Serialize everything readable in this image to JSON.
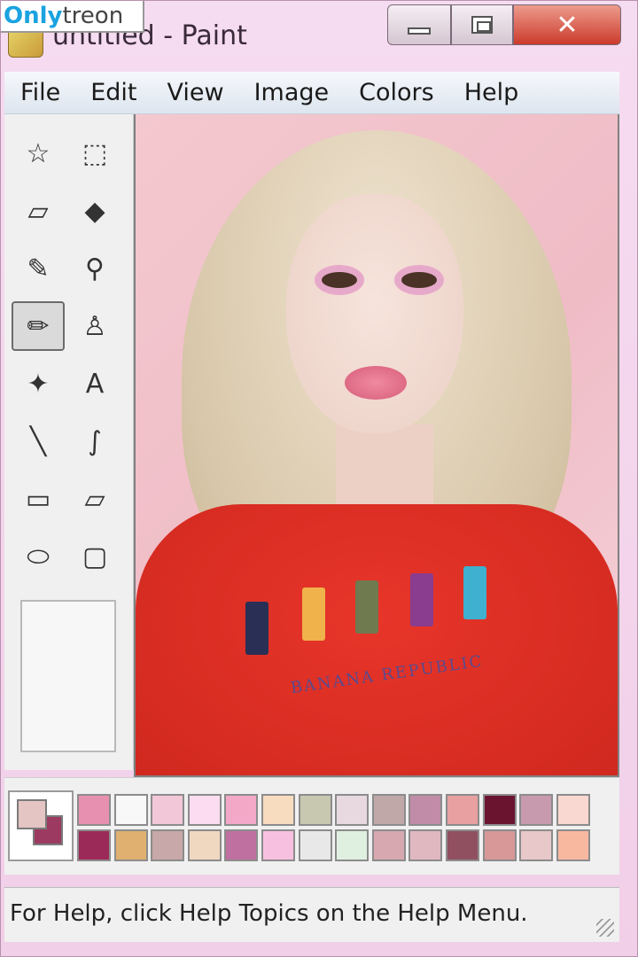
{
  "watermark": {
    "part1": "Only",
    "part2": "treon"
  },
  "window": {
    "title": "untitled - Paint",
    "close_glyph": "✕"
  },
  "menu": [
    "File",
    "Edit",
    "View",
    "Image",
    "Colors",
    "Help"
  ],
  "tools": [
    {
      "name": "free-form-select-icon",
      "glyph": "☆"
    },
    {
      "name": "select-icon",
      "glyph": "⬚"
    },
    {
      "name": "eraser-icon",
      "glyph": "▱"
    },
    {
      "name": "fill-bucket-icon",
      "glyph": "◆"
    },
    {
      "name": "color-picker-icon",
      "glyph": "✎"
    },
    {
      "name": "magnifier-icon",
      "glyph": "⚲"
    },
    {
      "name": "pencil-icon",
      "glyph": "✏",
      "selected": true
    },
    {
      "name": "brush-icon",
      "glyph": "♙"
    },
    {
      "name": "airbrush-icon",
      "glyph": "✦"
    },
    {
      "name": "text-icon",
      "glyph": "A"
    },
    {
      "name": "line-icon",
      "glyph": "╲"
    },
    {
      "name": "curve-icon",
      "glyph": "∫"
    },
    {
      "name": "rectangle-icon",
      "glyph": "▭"
    },
    {
      "name": "polygon-icon",
      "glyph": "⏥"
    },
    {
      "name": "ellipse-icon",
      "glyph": "⬭"
    },
    {
      "name": "rounded-rectangle-icon",
      "glyph": "▢"
    }
  ],
  "colors": {
    "foreground": "#e5c4c4",
    "background": "#9c3a61",
    "palette_top": [
      "#e890b0",
      "#f8f8f8",
      "#f2c8d8",
      "#fbdcf0",
      "#f4a8c8",
      "#f8dcc0",
      "#c8c8b0",
      "#e8d8e0",
      "#c0a8a8",
      "#c08ca8",
      "#e8a0a0",
      "#6a1430",
      "#c89aae",
      "#f8d8d0"
    ],
    "palette_bottom": [
      "#9c2a58",
      "#e0b070",
      "#c8a8a8",
      "#f0d8c0",
      "#c070a0",
      "#f8c0e0",
      "#e8e8e8",
      "#e0f0e0",
      "#d8a8b0",
      "#e0b8c0",
      "#905060",
      "#d89898",
      "#e8c8c8",
      "#f8b8a0"
    ]
  },
  "tshirt": {
    "brand": "BANANA REPUBLIC"
  },
  "status": {
    "text": "For Help, click Help Topics on the Help Menu."
  }
}
